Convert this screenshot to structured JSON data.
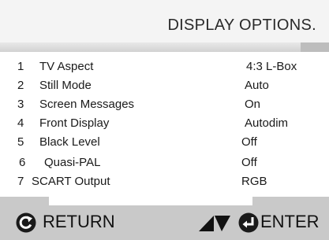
{
  "header": {
    "title": "DISPLAY OPTIONS."
  },
  "menu": {
    "items": [
      {
        "number": "1",
        "label": "TV Aspect",
        "value": "4:3 L-Box"
      },
      {
        "number": "2",
        "label": "Still Mode",
        "value": "Auto"
      },
      {
        "number": "3",
        "label": "Screen Messages",
        "value": "On"
      },
      {
        "number": "4",
        "label": "Front Display",
        "value": "Autodim"
      },
      {
        "number": "5",
        "label": "Black Level",
        "value": "Off"
      },
      {
        "number": "6",
        "label": "Quasi-PAL",
        "value": "Off"
      },
      {
        "number": "7",
        "label": "SCART Output",
        "value": "RGB"
      }
    ]
  },
  "footer": {
    "return_label": "RETURN",
    "return_icon": "return-icon",
    "navigate_icon": "up-down-arrows-icon",
    "enter_icon": "enter-icon",
    "enter_label": "ENTER"
  },
  "colors": {
    "background": "#ffffff",
    "band": "#c9c9c9",
    "text": "#1a1a1a"
  }
}
